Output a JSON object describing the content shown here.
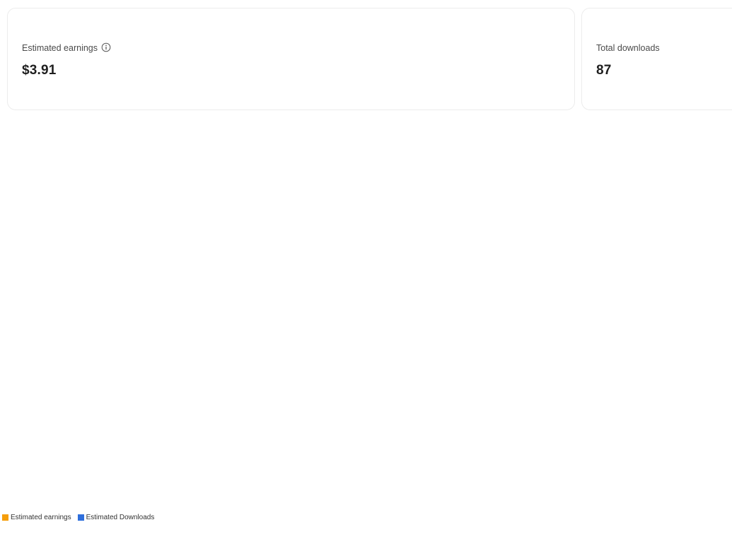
{
  "stats": {
    "earnings": {
      "label": "Estimated earnings",
      "value": "$3.91",
      "icon": "info-icon"
    },
    "downloads": {
      "label": "Total downloads",
      "value": "87"
    }
  },
  "legend": {
    "items": [
      {
        "label": "Estimated earnings",
        "color": "#f59e0b"
      },
      {
        "label": "Estimated Downloads",
        "color": "#2f6fdc"
      }
    ]
  }
}
